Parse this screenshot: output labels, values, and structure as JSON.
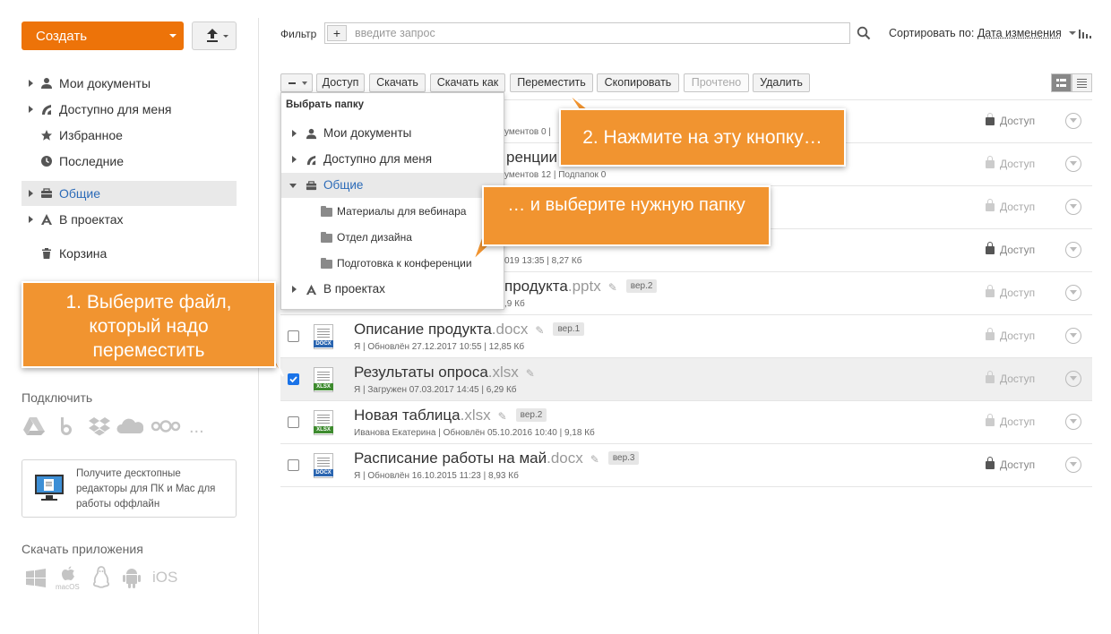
{
  "sidebar": {
    "create_label": "Создать",
    "items": [
      {
        "label": "Мои документы",
        "icon": "person-icon"
      },
      {
        "label": "Доступно для меня",
        "icon": "shared-icon"
      },
      {
        "label": "Избранное",
        "icon": "star-icon"
      },
      {
        "label": "Последние",
        "icon": "clock-icon"
      },
      {
        "label": "Общие",
        "icon": "common-icon"
      },
      {
        "label": "В проектах",
        "icon": "projects-icon"
      },
      {
        "label": "Корзина",
        "icon": "trash-icon"
      }
    ],
    "connect_title": "Подключить",
    "more_label": "...",
    "promo_text": "Получите десктопные редакторы для ПК и Mac для работы оффлайн",
    "apps_title": "Скачать приложения",
    "macos_label": "macOS",
    "ios_label": "iOS"
  },
  "filter": {
    "label": "Фильтр",
    "plus": "+",
    "placeholder": "введите запрос",
    "sort_prefix": "Сортировать по:",
    "sort_value": "Дата изменения"
  },
  "toolbar": {
    "access": "Доступ",
    "download": "Скачать",
    "download_as": "Скачать как",
    "move": "Переместить",
    "copy": "Скопировать",
    "read": "Прочтено",
    "delete": "Удалить"
  },
  "folder_dropdown": {
    "title": "Выбрать папку",
    "items": [
      "Мои документы",
      "Доступно для меня",
      "Общие"
    ],
    "subfolders": [
      "Материалы для вебинара",
      "Отдел дизайна",
      "Подготовка к конференции"
    ],
    "projects": "В проектах"
  },
  "rows": [
    {
      "name": "",
      "ext": "",
      "meta": "ументов 0 |",
      "access": "Доступ",
      "icon": "folder"
    },
    {
      "name": "ренции",
      "ext": "",
      "meta": "ументов 12 | Подпапок 0",
      "access": "Доступ",
      "icon": "folder"
    },
    {
      "name": "",
      "ext": "",
      "meta": "",
      "access": "Доступ",
      "icon": "docx"
    },
    {
      "name": "",
      "ext": "",
      "meta": "019 13:35 | 8,27 Кб",
      "access": "Доступ",
      "icon": "docx"
    },
    {
      "name": "продукта",
      "ext": ".pptx",
      "ver": "вер.2",
      "meta": ",9 Кб",
      "access": "Доступ",
      "icon": "pptx"
    },
    {
      "name": "Описание продукта",
      "ext": ".docx",
      "ver": "вер.1",
      "meta": "Я | Обновлён 27.12.2017 10:55 | 12,85 Кб",
      "access": "Доступ",
      "icon": "docx",
      "icon_tag": "DOCX"
    },
    {
      "name": "Результаты опроса",
      "ext": ".xlsx",
      "ver": "",
      "meta": "Я | Загружен 07.03.2017 14:45 | 6,29 Кб",
      "access": "Доступ",
      "icon": "xlsx",
      "icon_tag": "XLSX"
    },
    {
      "name": "Новая таблица",
      "ext": ".xlsx",
      "ver": "вер.2",
      "meta": "Иванова Екатерина | Обновлён 05.10.2016 10:40 | 9,18 Кб",
      "access": "Доступ",
      "icon": "xlsx",
      "icon_tag": "XLSX"
    },
    {
      "name": "Расписание работы на май",
      "ext": ".docx",
      "ver": "вер.3",
      "meta": "Я | Обновлён 16.10.2015 11:23 | 8,93 Кб",
      "access": "Доступ",
      "icon": "docx",
      "icon_tag": "DOCX"
    }
  ],
  "callouts": {
    "step1": "1. Выберите файл, который надо переместить",
    "step2": "2. Нажмите на эту кнопку…",
    "step3": "… и выберите нужную папку"
  },
  "colors": {
    "accent": "#ed7309",
    "callout": "#f19430",
    "link": "#2c6bb8"
  }
}
